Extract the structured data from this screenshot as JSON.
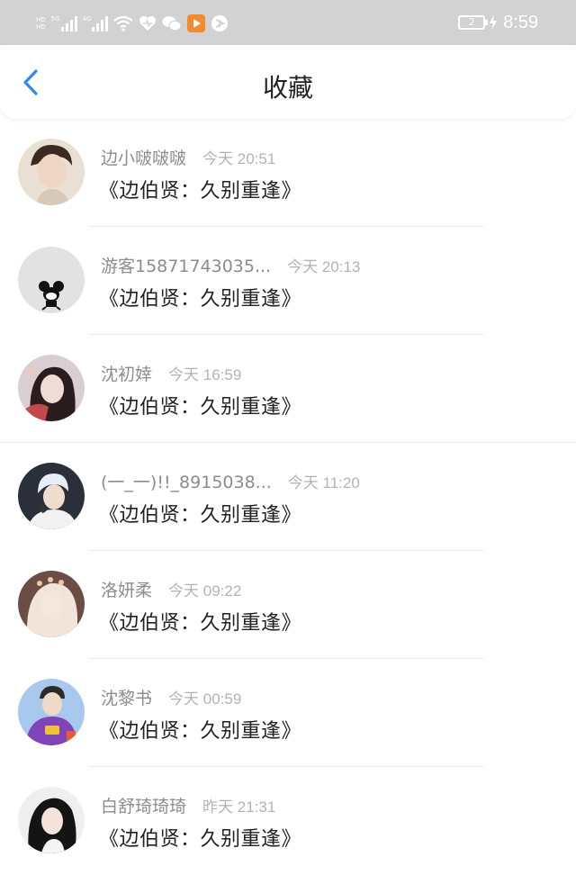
{
  "status_bar": {
    "hd1": "HD",
    "five_g": "5G",
    "hd2": "HD",
    "four_g": "4G",
    "battery": "2",
    "time": "8:59"
  },
  "header": {
    "title": "收藏"
  },
  "colors": {
    "accent": "#2f8be6",
    "status_bar_bg": "#d2d2d2",
    "name_text": "#8c8c8c",
    "time_text": "#b3b3b3"
  },
  "items": [
    {
      "name": "边小啵啵啵",
      "time": "今天 20:51",
      "book": "《边伯贤：久别重逢》"
    },
    {
      "name": "游客15871743035...",
      "time": "今天 20:13",
      "book": "《边伯贤：久别重逢》"
    },
    {
      "name": "沈初婞",
      "time": "今天 16:59",
      "book": "《边伯贤：久别重逢》"
    },
    {
      "name": "(一_一)!!_8915038...",
      "time": "今天 11:20",
      "book": "《边伯贤：久别重逢》"
    },
    {
      "name": "洛妍柔",
      "time": "今天 09:22",
      "book": "《边伯贤：久别重逢》"
    },
    {
      "name": "沈黎书",
      "time": "今天 00:59",
      "book": "《边伯贤：久别重逢》"
    },
    {
      "name": "白舒琦琦琦",
      "time": "昨天 21:31",
      "book": "《边伯贤：久别重逢》"
    }
  ]
}
